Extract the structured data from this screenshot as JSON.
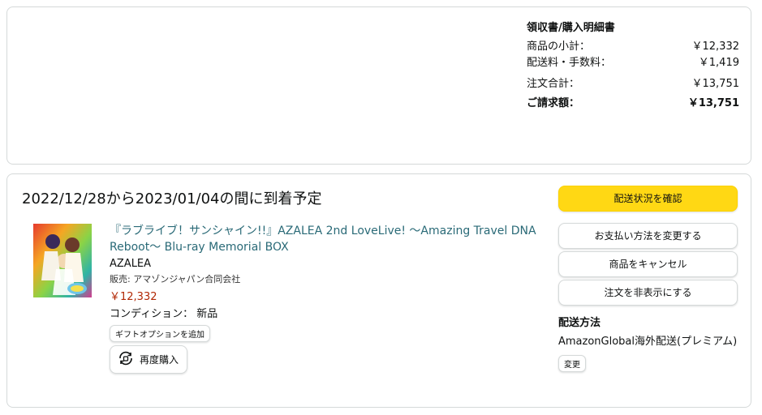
{
  "summary": {
    "title": "領収書/購入明細書",
    "rows": [
      {
        "label": "商品の小計：",
        "value": "￥12,332"
      },
      {
        "label": "配送料・手数料：",
        "value": "￥1,419"
      },
      {
        "label": "注文合計：",
        "value": "￥13,751"
      },
      {
        "label": "ご請求額：",
        "value": "￥13,751"
      }
    ]
  },
  "order": {
    "delivery_title": "2022/12/28から2023/01/04の間に到着予定",
    "product": {
      "title": "『ラブライブ！サンシャイン!!』AZALEA 2nd LoveLive! ～Amazing Travel DNA Reboot～ Blu-ray Memorial BOX",
      "brand": "AZALEA",
      "seller": "販売: アマゾンジャパン合同会社",
      "price": "￥12,332",
      "condition_label": "コンディション：",
      "condition_value": "新品",
      "gift_label": "ギフトオプションを追加",
      "rebuy_label": "再度購入"
    },
    "actions": {
      "track": "配送状況を確認",
      "change_payment": "お支払い方法を変更する",
      "cancel": "商品をキャンセル",
      "hide": "注文を非表示にする"
    },
    "shipping": {
      "label": "配送方法",
      "value": "AmazonGlobal海外配送(プレミアム)",
      "change": "変更"
    }
  },
  "colors": {
    "primary_button": "#ffd814",
    "link": "#2a6a77",
    "price": "#b12704"
  }
}
